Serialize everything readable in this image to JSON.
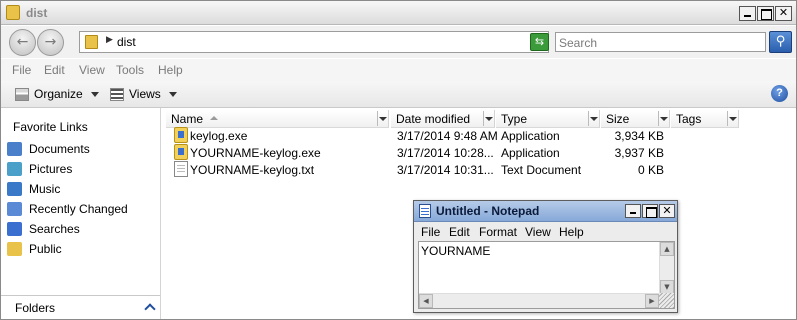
{
  "window": {
    "title": "dist"
  },
  "address": {
    "path": "dist",
    "search_placeholder": "Search"
  },
  "menu": [
    "File",
    "Edit",
    "View",
    "Tools",
    "Help"
  ],
  "toolbar": {
    "organize_label": "Organize",
    "views_label": "Views",
    "help_label": "?"
  },
  "nav": {
    "heading": "Favorite Links",
    "items": [
      {
        "label": "Documents",
        "icon": "documents-icon",
        "color": "#4a7fc9"
      },
      {
        "label": "Pictures",
        "icon": "pictures-icon",
        "color": "#4aa0c9"
      },
      {
        "label": "Music",
        "icon": "music-icon",
        "color": "#3a78c8"
      },
      {
        "label": "Recently Changed",
        "icon": "recently-changed-icon",
        "color": "#5a8ad6"
      },
      {
        "label": "Searches",
        "icon": "searches-icon",
        "color": "#3b6fcf"
      },
      {
        "label": "Public",
        "icon": "public-folder-icon",
        "color": "#e9c24a"
      }
    ],
    "folders_label": "Folders"
  },
  "columns": [
    "Name",
    "Date modified",
    "Type",
    "Size",
    "Tags"
  ],
  "files": [
    {
      "name": "keylog.exe",
      "date": "3/17/2014 9:48 AM",
      "type": "Application",
      "size": "3,934 KB",
      "icon": "exe-icon"
    },
    {
      "name": "YOURNAME-keylog.exe",
      "date": "3/17/2014 10:28...",
      "type": "Application",
      "size": "3,937 KB",
      "icon": "exe-icon"
    },
    {
      "name": "YOURNAME-keylog.txt",
      "date": "3/17/2014 10:31...",
      "type": "Text Document",
      "size": "0 KB",
      "icon": "text-file-icon"
    }
  ],
  "notepad": {
    "title": "Untitled - Notepad",
    "menu": [
      "File",
      "Edit",
      "Format",
      "View",
      "Help"
    ],
    "content": "YOURNAME"
  }
}
